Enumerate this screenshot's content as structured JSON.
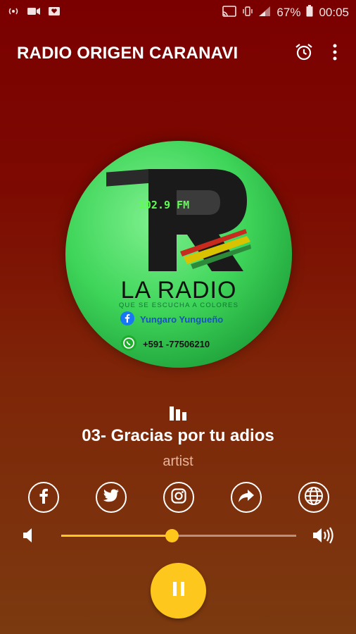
{
  "statusbar": {
    "battery": "67%",
    "time": "00:05"
  },
  "toolbar": {
    "title": "RADIO ORIGEN CARANAVI"
  },
  "logo": {
    "frequency": "102.9 FM",
    "name": "LA RADIO",
    "tagline": "QUE SE ESCUCHA A COLORES",
    "facebook": "Yungaro Yungueño",
    "whatsapp": "+591 -77506210"
  },
  "player": {
    "song_title": "03- Gracias por tu adios",
    "artist": "artist",
    "volume_level": 0.47
  },
  "social": [
    "facebook-icon",
    "twitter-icon",
    "instagram-icon",
    "share-icon",
    "globe-icon"
  ],
  "colors": {
    "accent": "#fdc71d",
    "background_top": "#7a0000",
    "background_bottom": "#7b3a10"
  }
}
